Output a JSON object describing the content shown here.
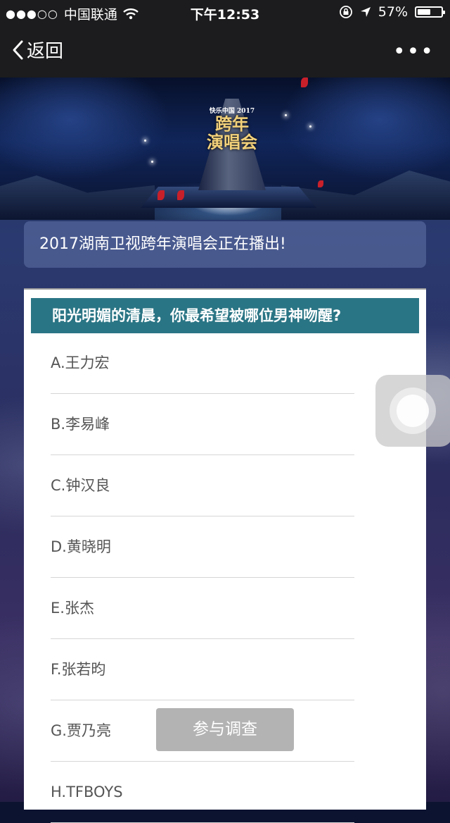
{
  "status_bar": {
    "signal": "●●●○○",
    "carrier": "中国联通",
    "time": "下午12:53",
    "battery_percent": "57%",
    "battery_level": 0.57
  },
  "nav": {
    "back_label": "返回",
    "more_label": "•••"
  },
  "banner": {
    "logo_line1": "快乐中国 2017",
    "logo_line2": "跨年",
    "logo_line3": "演唱会"
  },
  "notice": {
    "text": "2017湖南卫视跨年演唱会正在播出!"
  },
  "survey": {
    "question": "阳光明媚的清晨，你最希望被哪位男神吻醒?",
    "options": [
      "A.王力宏",
      "B.李易峰",
      "C.钟汉良",
      "D.黄晓明",
      "E.张杰",
      "F.张若昀",
      "G.贾乃亮",
      "H.TFBOYS"
    ],
    "submit_label": "参与调查"
  },
  "colors": {
    "question_bg": "#2a7585",
    "submit_bg": "#b3b3b3",
    "bar_bg": "#1c1c1e"
  }
}
